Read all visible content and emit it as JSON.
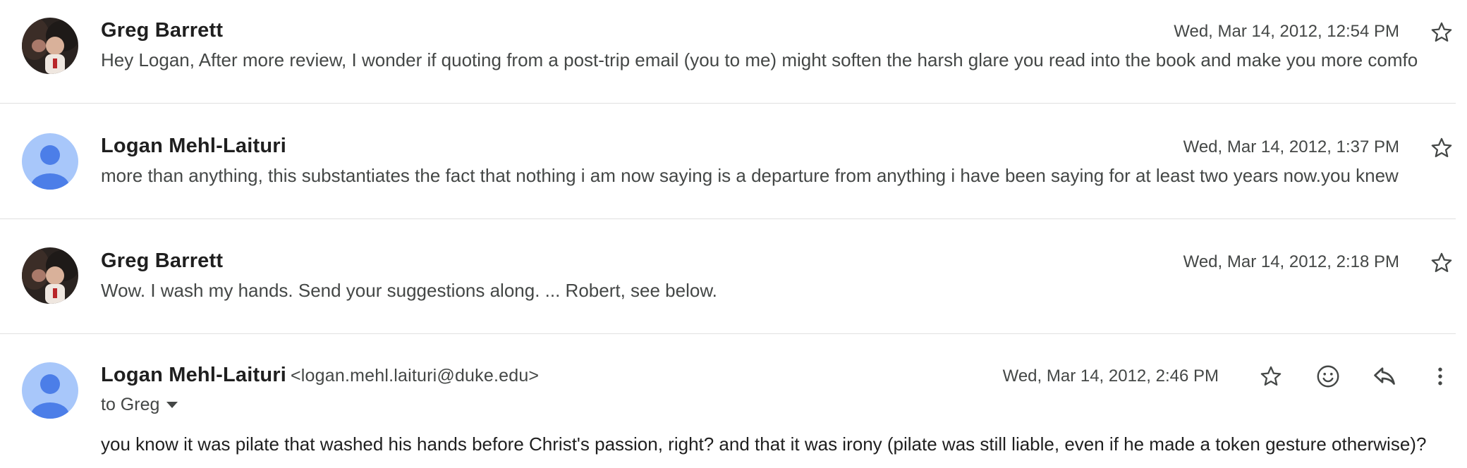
{
  "messages": [
    {
      "sender": "Greg Barrett",
      "date": "Wed, Mar 14, 2012, 12:54 PM",
      "snippet": "Hey Logan, After more review, I wonder if quoting from a post-trip email (you to me) might soften the harsh glare you read into the book and make you more comfo",
      "avatar": "photo"
    },
    {
      "sender": "Logan Mehl-Laituri",
      "date": "Wed, Mar 14, 2012, 1:37 PM",
      "snippet": "more than anything, this substantiates the fact that nothing i am now saying is a departure from anything i have been saying for at least two years now.you knew",
      "avatar": "default-person"
    },
    {
      "sender": "Greg Barrett",
      "date": "Wed, Mar 14, 2012, 2:18 PM",
      "snippet": "Wow. I wash my hands. Send your suggestions along. ... Robert, see below.",
      "avatar": "photo"
    }
  ],
  "expanded": {
    "sender": "Logan Mehl-Laituri",
    "email": "<logan.mehl.laituri@duke.edu>",
    "date": "Wed, Mar 14, 2012, 2:46 PM",
    "to_label": "to Greg",
    "body": "you know it was pilate that washed his hands before Christ's passion, right? and that it was irony (pilate was still liable, even if he made a token gesture otherwise)?",
    "avatar": "default-person"
  },
  "icons": {
    "star": "star-icon",
    "emoji": "emoji-react-icon",
    "reply": "reply-icon",
    "more": "more-vert-icon",
    "dropdown": "chevron-down-icon"
  },
  "colors": {
    "avatar_bg": "#a8c7fa",
    "avatar_fg": "#4c7ee8",
    "icon": "#444746"
  }
}
